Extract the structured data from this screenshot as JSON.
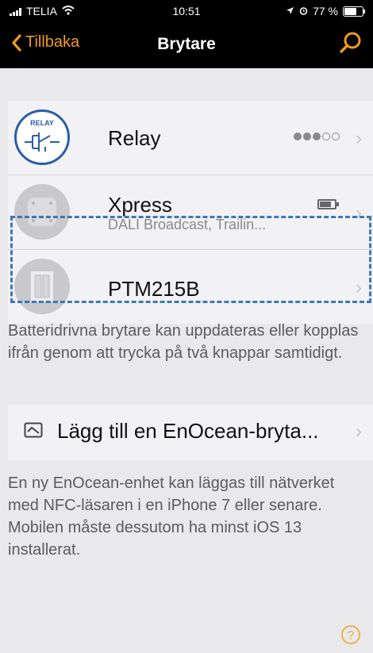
{
  "status_bar": {
    "carrier": "TELIA",
    "time": "10:51",
    "battery_percent": "77 %",
    "battery_level": 0.77
  },
  "nav": {
    "back_label": "Tillbaka",
    "title": "Brytare",
    "accent_color": "#f09a1d",
    "search_icon": "search-icon"
  },
  "switches": [
    {
      "name": "Relay",
      "subtitle": "",
      "icon": "relay-icon",
      "icon_text": "RELAY",
      "signal_strength": 3,
      "signal_max": 5
    },
    {
      "name": "Xpress",
      "subtitle": "DALI Broadcast, Trailin...",
      "icon": "xpress-device-icon",
      "battery_icon": "battery-icon"
    },
    {
      "name": "PTM215B",
      "subtitle": "",
      "icon": "ptm-switch-icon"
    }
  ],
  "battery_note": "Batteridrivna brytare kan uppdateras eller kopplas ifrån genom att trycka på två knappar samtidigt.",
  "add_row": {
    "label": "Lägg till en EnOcean-bryta...",
    "icon": "add-enocean-icon"
  },
  "nfc_note": "En ny EnOcean-enhet kan läggas till nätverket med NFC-läsaren i en iPhone 7 eller senare. Mobilen måste dessutom ha minst iOS 13 installerat.",
  "help_label": "?"
}
